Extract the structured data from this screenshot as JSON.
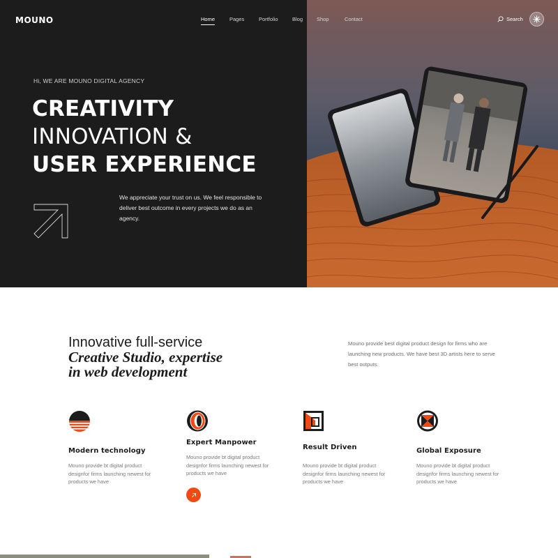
{
  "brand": {
    "logo": "MOUNO"
  },
  "nav": {
    "items": [
      {
        "label": "Home",
        "active": true
      },
      {
        "label": "Pages",
        "active": false
      },
      {
        "label": "Portfolio",
        "active": false
      },
      {
        "label": "Blog",
        "active": false
      },
      {
        "label": "Shop",
        "active": false
      },
      {
        "label": "Contact",
        "active": false
      }
    ],
    "search_label": "Search",
    "menu_icon": "asterisk-menu-icon"
  },
  "hero": {
    "tagline": "Hi, WE ARE MOUNO DIGITAL AGENCY",
    "line1": "CREATIVITY",
    "line2": "INNOVATION &",
    "line3": "USER EXPERIENCE",
    "description": "We appreciate your trust on us. We feel responsible to deliver best outcome in every projects we do as an agency.",
    "arrow_icon": "arrow-up-right-icon",
    "image_subject": "two tablets and a stylus over desert dunes"
  },
  "about": {
    "title_plain": "Innovative full-service",
    "title_italic_1": "Creative Studio, expertise",
    "title_italic_2": "in web development",
    "description": "Mouno provide best digital product design for firms who are launching new products. We have best 3D artists here to serve best outputs."
  },
  "features": [
    {
      "icon": "striped-circle-icon",
      "title": "Modern technology",
      "description": "Mouno provide bt digital product designfor firms launching newest for products we have"
    },
    {
      "icon": "ring-icon",
      "title": "Expert Manpower",
      "description": "Mouno provide bt digital product designfor firms launching newest for products we have",
      "button_icon": "arrow-up-right-icon"
    },
    {
      "icon": "frame-box-icon",
      "title": "Result Driven",
      "description": "Mouno provide bt digital product designfor firms launching newest for products we have"
    },
    {
      "icon": "globe-cross-icon",
      "title": "Global Exposure",
      "description": "Mouno provide bt digital product designfor firms launching newest for products we have"
    }
  ],
  "colors": {
    "accent": "#f04a12",
    "dark": "#1c1c1d",
    "sand": "#c8642a"
  }
}
